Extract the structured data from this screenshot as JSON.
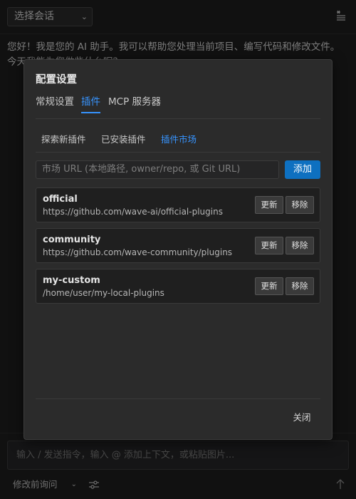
{
  "header": {
    "session_select": "选择会话",
    "menu_icon": "list-icon"
  },
  "chat": {
    "message": "您好！我是您的 AI 助手。我可以帮助您处理当前项目、编写代码和修改文件。今天我能为您做些什么呢？"
  },
  "input": {
    "placeholder": "输入 / 发送指令，输入 @ 添加上下文，或粘贴图片...",
    "mode": "修改前询问"
  },
  "modal": {
    "title": "配置设置",
    "main_tabs": [
      {
        "label": "常规设置",
        "active": false
      },
      {
        "label": "插件",
        "active": true
      },
      {
        "label": "MCP 服务器",
        "active": false
      }
    ],
    "sub_tabs": [
      {
        "label": "探索新插件",
        "active": false
      },
      {
        "label": "已安装插件",
        "active": false
      },
      {
        "label": "插件市场",
        "active": true
      }
    ],
    "url_placeholder": "市场 URL (本地路径, owner/repo, 或 Git URL)",
    "add_label": "添加",
    "markets": [
      {
        "name": "official",
        "url": "https://github.com/wave-ai/official-plugins",
        "update": "更新",
        "remove": "移除"
      },
      {
        "name": "community",
        "url": "https://github.com/wave-community/plugins",
        "update": "更新",
        "remove": "移除"
      },
      {
        "name": "my-custom",
        "url": "/home/user/my-local-plugins",
        "update": "更新",
        "remove": "移除"
      }
    ],
    "close_label": "关闭"
  },
  "colors": {
    "accent": "#3794ff",
    "primary_button": "#0e70c0",
    "background": "#1e1e1e",
    "modal_background": "#2b2b2b"
  }
}
